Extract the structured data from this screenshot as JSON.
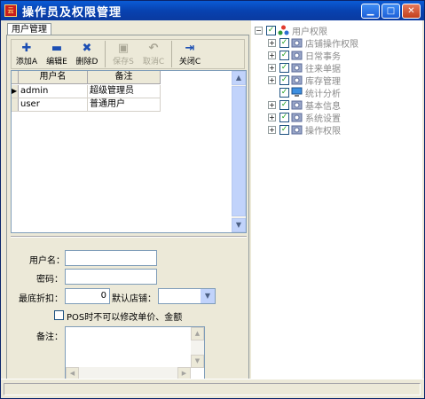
{
  "window": {
    "title": "操作员及权限管理",
    "app_icon_text": "云",
    "buttons": [
      "minimize",
      "maximize",
      "close"
    ]
  },
  "tab": {
    "label": "用户管理"
  },
  "toolbar": {
    "add_label": "添加A",
    "edit_label": "编辑E",
    "delete_label": "删除D",
    "save_label": "保存S",
    "cancel_label": "取消C",
    "close_label": "关闭C"
  },
  "grid": {
    "columns": [
      "用户名",
      "备注"
    ],
    "rows": [
      {
        "username": "admin",
        "note": "超级管理员",
        "selected": true
      },
      {
        "username": "user",
        "note": "普通用户",
        "selected": false
      }
    ]
  },
  "form": {
    "username_label": "用户名：",
    "username_value": "",
    "password_label": "密码：",
    "password_value": "",
    "discount_label": "最底折扣：",
    "discount_value": "0",
    "default_shop_label": "默认店铺：",
    "default_shop_value": "",
    "pos_checkbox_label": "POS时不可以修改单价、金额",
    "pos_checkbox_checked": false,
    "remark_label": "备注：",
    "remark_value": ""
  },
  "permissions_tree": {
    "root": {
      "label": "用户权限",
      "checked": true,
      "expanded": true
    },
    "children": [
      {
        "label": "店铺操作权限",
        "checked": true,
        "expandable": true
      },
      {
        "label": "日常事务",
        "checked": true,
        "expandable": true
      },
      {
        "label": "往来单据",
        "checked": true,
        "expandable": true
      },
      {
        "label": "库存管理",
        "checked": true,
        "expandable": true
      },
      {
        "label": "统计分析",
        "checked": true,
        "expandable": false
      },
      {
        "label": "基本信息",
        "checked": true,
        "expandable": true
      },
      {
        "label": "系统设置",
        "checked": true,
        "expandable": true
      },
      {
        "label": "操作权限",
        "checked": true,
        "expandable": true
      }
    ]
  }
}
